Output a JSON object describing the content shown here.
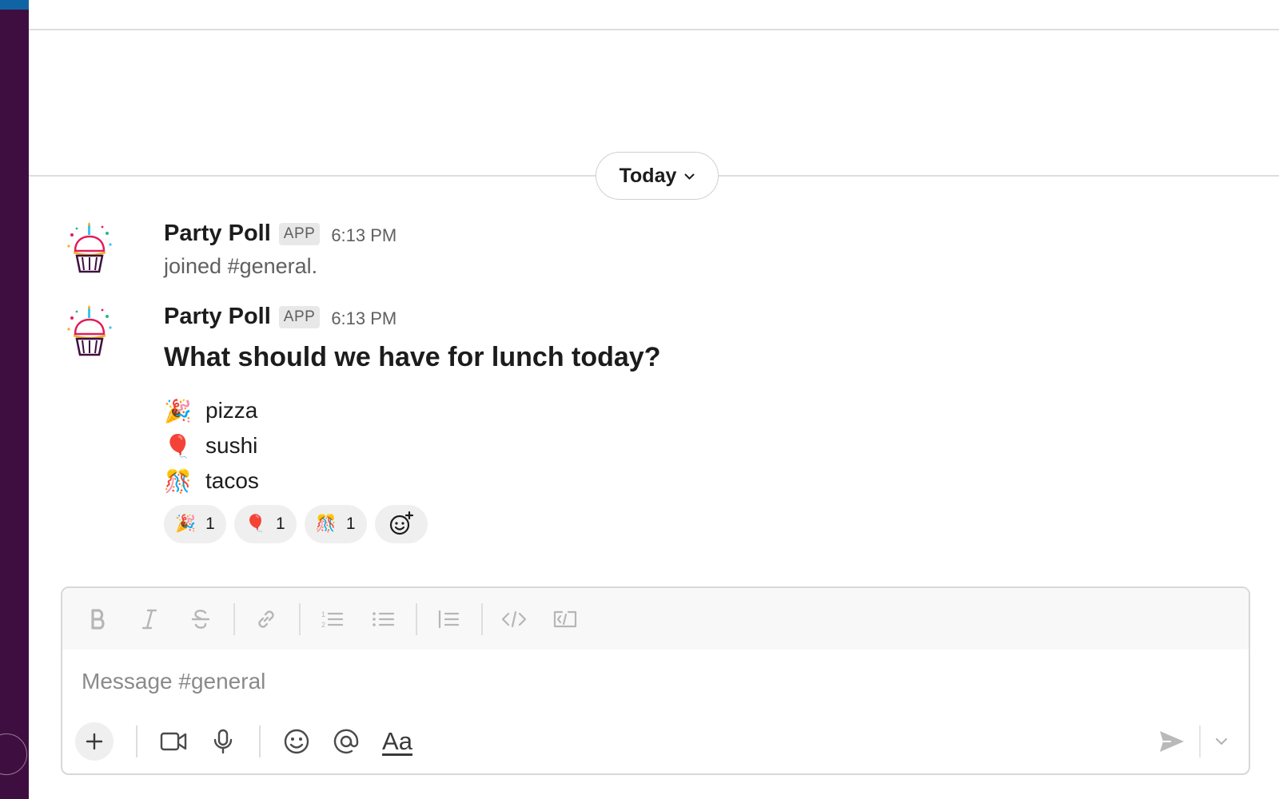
{
  "channel": {
    "name": "#general"
  },
  "date_divider": {
    "label": "Today"
  },
  "messages": [
    {
      "sender": "Party Poll",
      "badge": "APP",
      "time": "6:13 PM",
      "text": "joined #general."
    },
    {
      "sender": "Party Poll",
      "badge": "APP",
      "time": "6:13 PM",
      "question": "What should we have for lunch today?",
      "options": [
        {
          "emoji": "🎉",
          "icon": "party-popper-icon",
          "label": "pizza"
        },
        {
          "emoji": "🎈",
          "icon": "balloon-icon",
          "label": "sushi"
        },
        {
          "emoji": "🎊",
          "icon": "confetti-ball-icon",
          "label": "tacos"
        }
      ],
      "reactions": [
        {
          "emoji": "🎉",
          "icon": "party-popper-icon",
          "count": "1"
        },
        {
          "emoji": "🎈",
          "icon": "balloon-icon",
          "count": "1"
        },
        {
          "emoji": "🎊",
          "icon": "confetti-ball-icon",
          "count": "1"
        }
      ]
    }
  ],
  "composer": {
    "placeholder": "Message #general",
    "value": "",
    "format_tools": [
      "bold-icon",
      "italic-icon",
      "strikethrough-icon",
      "link-icon",
      "ordered-list-icon",
      "bulleted-list-icon",
      "blockquote-icon",
      "code-icon",
      "code-block-icon"
    ],
    "bottom_tools": [
      "plus-icon",
      "video-icon",
      "microphone-icon",
      "emoji-icon",
      "mention-icon",
      "formatting-icon"
    ],
    "formatting_label": "Aa"
  },
  "colors": {
    "sidebar": "#3f0e40",
    "sidebar_accent": "#1164a3",
    "text": "#1d1c1d",
    "muted": "#616061",
    "divider": "#dddddd"
  }
}
